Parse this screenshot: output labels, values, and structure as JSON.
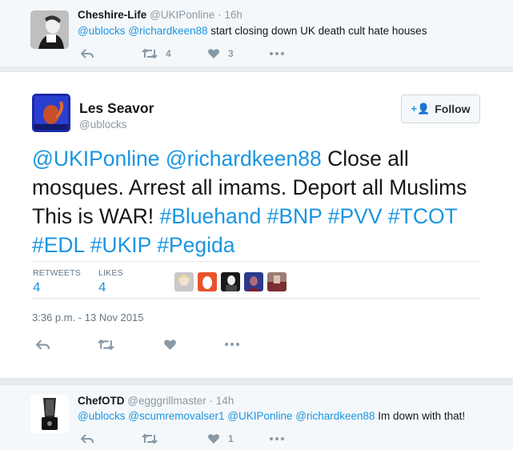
{
  "tweet1": {
    "name": "Cheshire-Life",
    "handle": "@UKIPonline",
    "dot": "·",
    "time": "16h",
    "mention1": "@ublocks",
    "mention2": "@richardkeen88",
    "text": "start closing down UK death cult hate houses",
    "retweets": "4",
    "likes": "3"
  },
  "main": {
    "name": "Les Seavor",
    "handle": "@ublocks",
    "follow_label": "Follow",
    "mention1": "@UKIPonline",
    "mention2": "@richardkeen88",
    "text": "Close all mosques. Arrest all imams. Deport all Muslims This is WAR!",
    "hashtags": [
      "#Bluehand",
      "#BNP",
      "#PVV",
      "#TCOT",
      "#EDL",
      "#UKIP",
      "#Pegida"
    ],
    "retweets_label": "RETWEETS",
    "retweets": "4",
    "likes_label": "LIKES",
    "likes": "4",
    "timestamp": "3:36 p.m. - 13 Nov 2015"
  },
  "tweet3": {
    "name": "ChefOTD",
    "handle": "@egggrillmaster",
    "dot": "·",
    "time": "14h",
    "mention1": "@ublocks",
    "mention2": "@scumremovalser1",
    "mention3": "@UKIPonline",
    "mention4": "@richardkeen88",
    "text": "Im down with that!",
    "likes": "1"
  },
  "colors": {
    "link": "#1b95e0",
    "muted": "#8899a6",
    "bg": "#e6ecf0"
  },
  "icons": [
    "reply-icon",
    "retweet-icon",
    "like-icon",
    "more-icon",
    "follow-person-icon"
  ]
}
